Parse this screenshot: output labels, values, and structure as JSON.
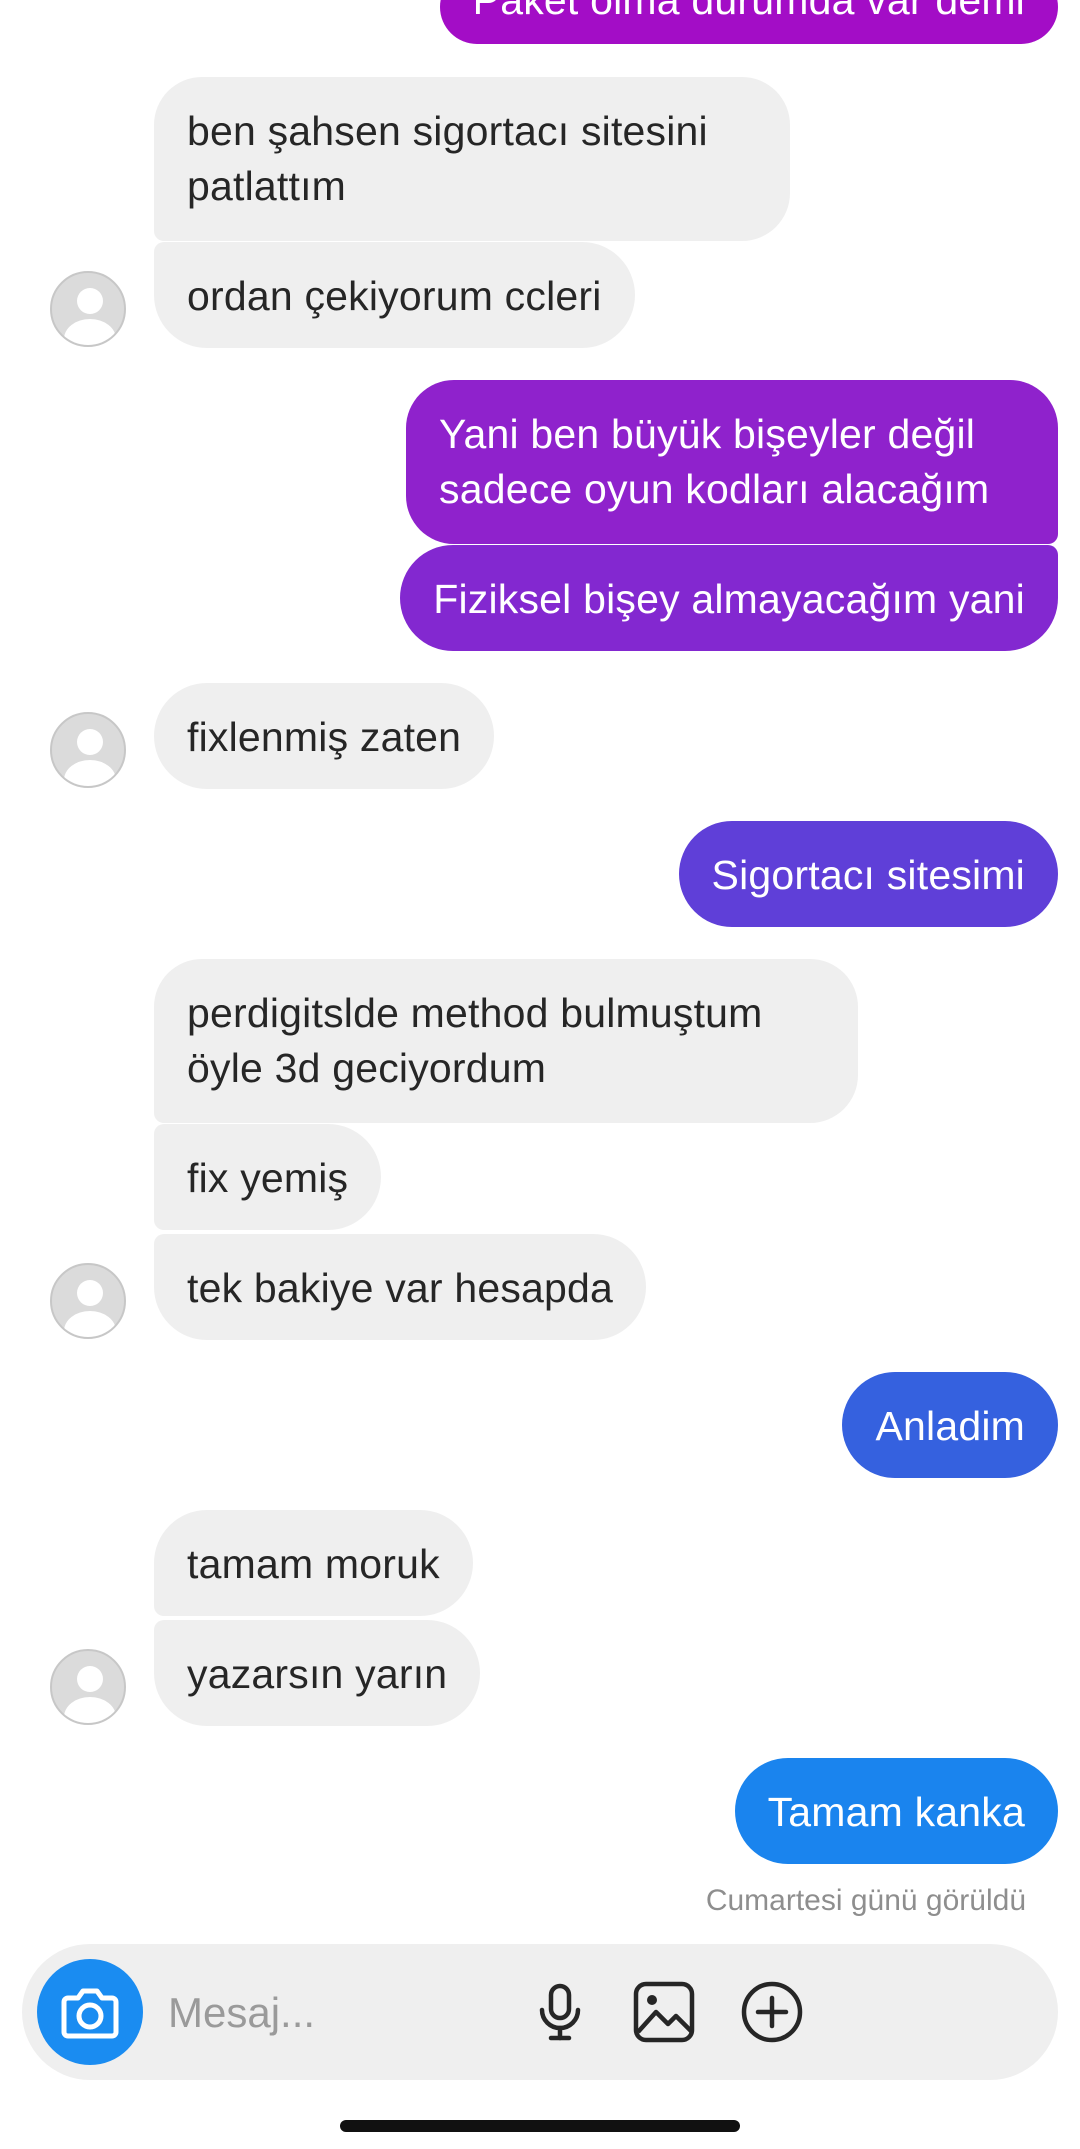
{
  "messages": [
    {
      "direction": "out",
      "text": "Paket olma durumda var demi"
    },
    {
      "direction": "in",
      "text": "ben şahsen sigortacı sitesini\npatlattım"
    },
    {
      "direction": "in",
      "text": "ordan çekiyorum ccleri"
    },
    {
      "direction": "out",
      "text": "Yani ben büyük bişeyler değil\nsadece oyun kodları alacağım"
    },
    {
      "direction": "out",
      "text": "Fiziksel bişey almayacağım yani"
    },
    {
      "direction": "in",
      "text": "fixlenmiş zaten"
    },
    {
      "direction": "out",
      "text": "Sigortacı sitesimi"
    },
    {
      "direction": "in",
      "text": "perdigitslde method bulmuştum\nöyle 3d geciyordum"
    },
    {
      "direction": "in",
      "text": "fix yemiş"
    },
    {
      "direction": "in",
      "text": "tek bakiye var hesapda"
    },
    {
      "direction": "out",
      "text": "Anladim"
    },
    {
      "direction": "in",
      "text": "tamam moruk"
    },
    {
      "direction": "in",
      "text": "yazarsın yarın"
    },
    {
      "direction": "out",
      "text": "Tamam kanka"
    }
  ],
  "seen_status": "Cumartesi günü görüldü",
  "composer": {
    "placeholder": "Mesaj...",
    "icons": [
      "camera-icon",
      "microphone-icon",
      "gallery-icon",
      "plus-circle-icon"
    ]
  },
  "colors": {
    "incoming_bubble": "#efefef",
    "gradient_top": "#a10fc4",
    "gradient_bottom": "#1a86f0",
    "camera_button": "#1a8cf1"
  }
}
